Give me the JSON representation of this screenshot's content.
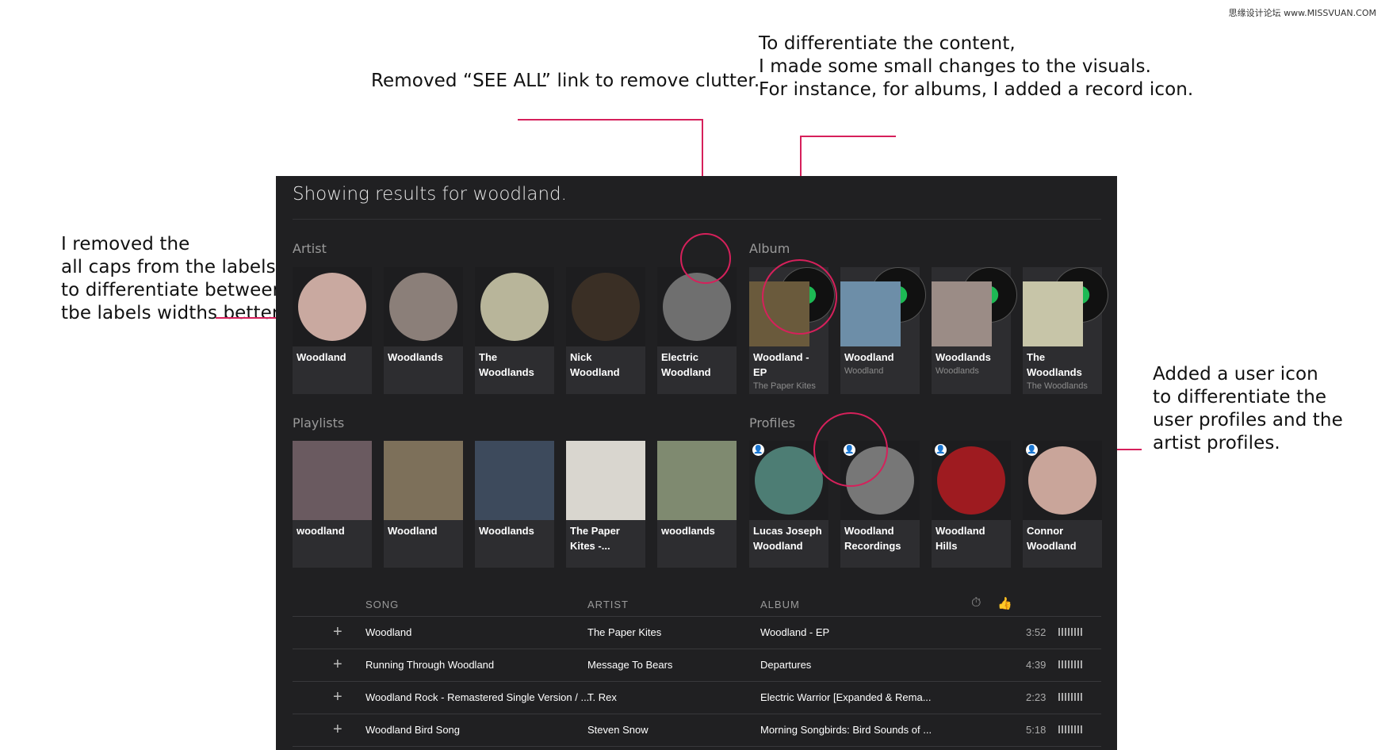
{
  "watermark": "思缘设计论坛 www.MISSVUAN.COM",
  "annotations": {
    "see_all": "Removed “SEE ALL” link to remove clutter.",
    "visuals": "To differentiate the content,\nI made some small changes to the visuals.\nFor instance, for albums, I added a record icon.",
    "caps": "I removed the\nall caps from the labels\nto differentiate between\ntbe labels widths better.",
    "user_icon": "Added a user icon\nto differentiate the\nuser profiles and the\nartist profiles."
  },
  "panel_title": "Showing results for woodland.",
  "sections": {
    "artist": "Artist",
    "album": "Album",
    "playlists": "Playlists",
    "profiles": "Profiles"
  },
  "artists": [
    {
      "name": "Woodland",
      "color": "#c9a9a0"
    },
    {
      "name": "Woodlands",
      "color": "#8b7f79"
    },
    {
      "name": "The Woodlands",
      "color": "#b8b59a"
    },
    {
      "name": "Nick Woodland",
      "color": "#3a2f25"
    },
    {
      "name": "Electric Woodland",
      "color": "#6f6f6f"
    }
  ],
  "albums": [
    {
      "title": "Woodland - EP",
      "sub": "The Paper Kites",
      "color": "#6a5a3c"
    },
    {
      "title": "Woodland",
      "sub": "Woodland",
      "color": "#6d8ea8"
    },
    {
      "title": "Woodlands",
      "sub": "Woodlands",
      "color": "#9b8c86"
    },
    {
      "title": "The Woodlands",
      "sub": "The Woodlands",
      "color": "#c7c5a8"
    }
  ],
  "playlists": [
    {
      "name": "woodland",
      "color": "#6a5a60"
    },
    {
      "name": "Woodland",
      "color": "#7d705a"
    },
    {
      "name": "Woodlands",
      "color": "#3d4a5c"
    },
    {
      "name": "The Paper Kites -...",
      "color": "#d9d6cf"
    },
    {
      "name": "woodlands",
      "color": "#7f8a70"
    }
  ],
  "profiles": [
    {
      "name": "Lucas Joseph Woodland",
      "color": "#4d7d74"
    },
    {
      "name": "Woodland Recordings",
      "color": "#777777"
    },
    {
      "name": "Woodland Hills",
      "color": "#9e1b20"
    },
    {
      "name": "Connor Woodland",
      "color": "#c9a59a"
    }
  ],
  "songs": {
    "headers": {
      "song": "SONG",
      "artist": "ARTIST",
      "album": "ALBUM"
    },
    "rows": [
      {
        "song": "Woodland",
        "artist": "The Paper Kites",
        "album": "Woodland - EP",
        "time": "3:52"
      },
      {
        "song": "Running Through Woodland",
        "artist": "Message To Bears",
        "album": "Departures",
        "time": "4:39"
      },
      {
        "song": "Woodland Rock - Remastered Single Version / ...",
        "artist": "T. Rex",
        "album": "Electric Warrior [Expanded & Rema...",
        "time": "2:23"
      },
      {
        "song": "Woodland Bird Song",
        "artist": "Steven Snow",
        "album": "Morning Songbirds: Bird Sounds of ...",
        "time": "5:18"
      }
    ]
  },
  "icons": {
    "plus": "+",
    "user": "👤",
    "timer": "⏱",
    "thumb": "👍"
  },
  "accent": "#d6205b"
}
